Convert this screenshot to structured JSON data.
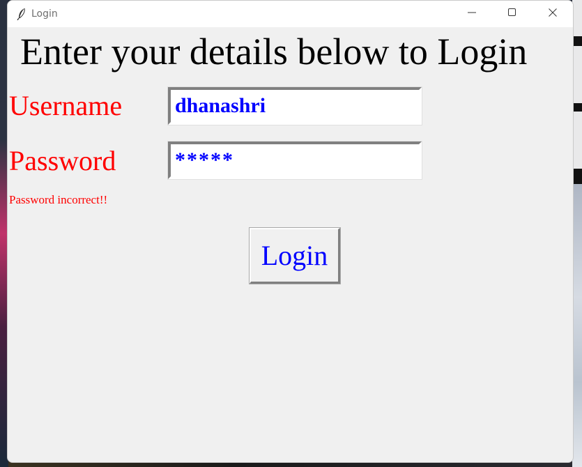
{
  "window": {
    "title": "Login",
    "icon": "feather-icon"
  },
  "controls": {
    "minimize_icon": "minimize-icon",
    "maximize_icon": "maximize-icon",
    "close_icon": "close-icon"
  },
  "form": {
    "heading": "Enter your details below to Login",
    "username_label": "Username",
    "username_value": "dhanashri",
    "password_label": "Password",
    "password_value": "*****",
    "error_message": "Password incorrect!!",
    "login_button": "Login"
  },
  "colors": {
    "label": "#ff0000",
    "entry_text": "#0000ff",
    "button_text": "#0000ff",
    "error": "#ff0000",
    "background": "#f0f0f0"
  }
}
